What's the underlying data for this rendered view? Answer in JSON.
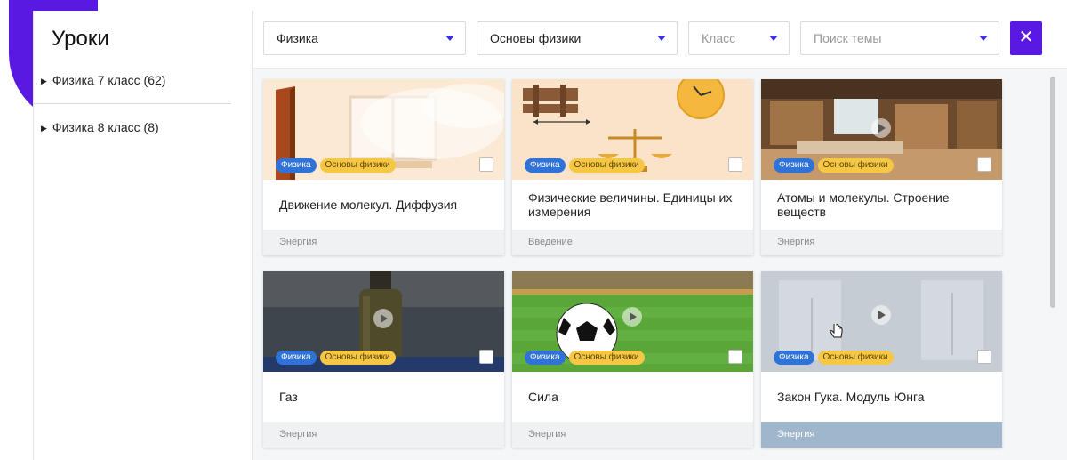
{
  "sidebar": {
    "title": "Уроки",
    "items": [
      {
        "label": "Физика 7 класс (62)"
      },
      {
        "label": "Физика 8 класс (8)"
      }
    ]
  },
  "filters": {
    "subject": "Физика",
    "course": "Основы физики",
    "grade_placeholder": "Класс",
    "topic_placeholder": "Поиск темы",
    "close_label": "✕"
  },
  "cards": [
    {
      "title": "Движение молекул. Диффузия",
      "tags": [
        "Физика",
        "Основы физики"
      ],
      "category": "Энергия"
    },
    {
      "title": "Физические величины. Единицы их измерения",
      "tags": [
        "Физика",
        "Основы физики"
      ],
      "category": "Введение"
    },
    {
      "title": "Атомы и молекулы. Строение веществ",
      "tags": [
        "Физика",
        "Основы физики"
      ],
      "category": "Энергия"
    },
    {
      "title": "Газ",
      "tags": [
        "Физика",
        "Основы физики"
      ],
      "category": "Энергия"
    },
    {
      "title": "Сила",
      "tags": [
        "Физика",
        "Основы физики"
      ],
      "category": "Энергия"
    },
    {
      "title": "Закон Гука. Модуль Юнга",
      "tags": [
        "Физика",
        "Основы физики"
      ],
      "category": "Энергия"
    }
  ],
  "colors": {
    "accent": "#5a18e3",
    "tag_blue": "#2f73d9",
    "tag_yellow": "#f6c744",
    "active_footer": "#9fb6cc"
  }
}
